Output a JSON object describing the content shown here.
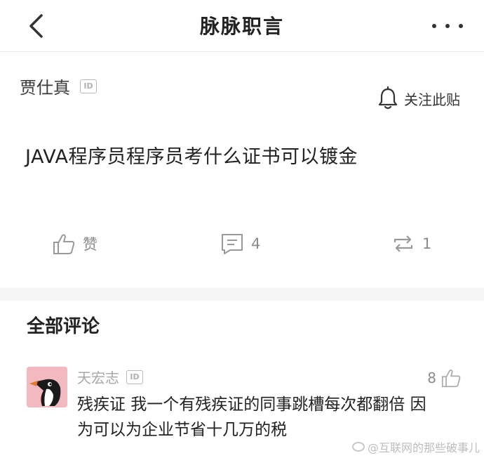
{
  "header": {
    "title": "脉脉职言",
    "back_icon": "chevron-left-icon",
    "more_icon": "more-horizontal-icon"
  },
  "post": {
    "author": "贾仕真",
    "id_badge": "ID",
    "follow_label": "关注此贴",
    "title": "JAVA程序员程序员考什么证书可以镀金",
    "like_label": "赞",
    "comment_count": "4",
    "share_count": "1"
  },
  "comments": {
    "header": "全部评论",
    "items": [
      {
        "author": "天宏志",
        "id_badge": "ID",
        "likes": "8",
        "text": "残疾证 我一个有残疾证的同事跳槽每次都翻倍 因为可以为企业节省十几万的税"
      }
    ]
  },
  "watermark": "@互联网的那些破事儿",
  "colors": {
    "accent_text": "#222222",
    "muted": "#8c8c8c",
    "divider": "#f6f6f6",
    "avatar_bg": "#f3b9c0"
  }
}
